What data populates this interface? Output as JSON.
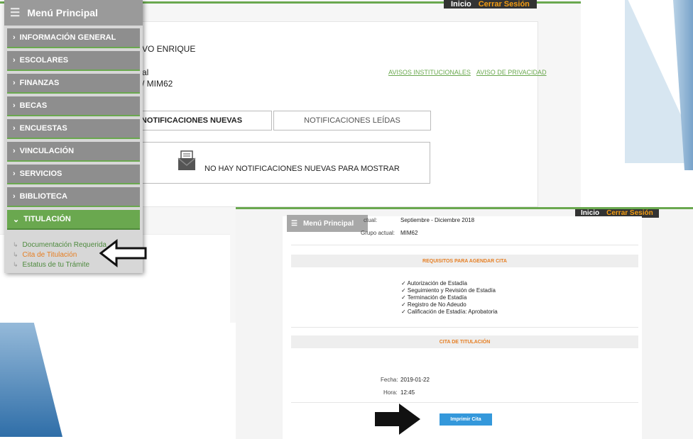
{
  "top_nav": {
    "home": "Inicio",
    "logout": "Cerrar Sesión"
  },
  "menu": {
    "title": "Menú Principal",
    "items": [
      {
        "label": "INFORMACIÓN GENERAL"
      },
      {
        "label": "ESCOLARES"
      },
      {
        "label": "FINANZAS"
      },
      {
        "label": "BECAS"
      },
      {
        "label": "ENCUESTAS"
      },
      {
        "label": "VINCULACIÓN"
      },
      {
        "label": "SERVICIOS"
      },
      {
        "label": "BIBLIOTECA"
      },
      {
        "label": "TITULACIÓN"
      }
    ],
    "sub_items": [
      {
        "label": "Documentación Requerida"
      },
      {
        "label": "Cita de Titulación"
      },
      {
        "label": "Estatus de tu Trámite"
      }
    ]
  },
  "profile": {
    "name_fragment": "VO ENRIQUE",
    "line2_fragment": "al",
    "line3_fragment": "/ MIM62"
  },
  "links": {
    "avisos": "AVISOS INSTITUCIONALES",
    "privacidad": "AVISO DE PRIVACIDAD"
  },
  "tabs": {
    "new": "NOTIFICACIONES NUEVAS",
    "read": "NOTIFICACIONES LEÍDAS"
  },
  "notification": {
    "empty_text": "NO HAY NOTIFICACIONES NUEVAS PARA MOSTRAR"
  },
  "shot2": {
    "menu_title": "Menú Principal",
    "period_label": "ctual:",
    "period_value": "Septiembre - Diciembre 2018",
    "group_label": "Grupo actual:",
    "group_value": "MIM62",
    "requirements_header": "REQUISITOS PARA AGENDAR CITA",
    "requirements": [
      "✓ Autorización de Estadía",
      "✓ Seguimiento y Revisión de Estadía",
      "✓ Terminación de Estadía",
      "✓ Registro de No Adeudo",
      "✓ Calificación de Estadía: Aprobatoria"
    ],
    "appointment_header": "CITA DE TITULACIÓN",
    "date_label": "Fecha:",
    "date_value": "2019-01-22",
    "time_label": "Hora:",
    "time_value": "12:45",
    "print_button": "Imprimir Cita"
  }
}
